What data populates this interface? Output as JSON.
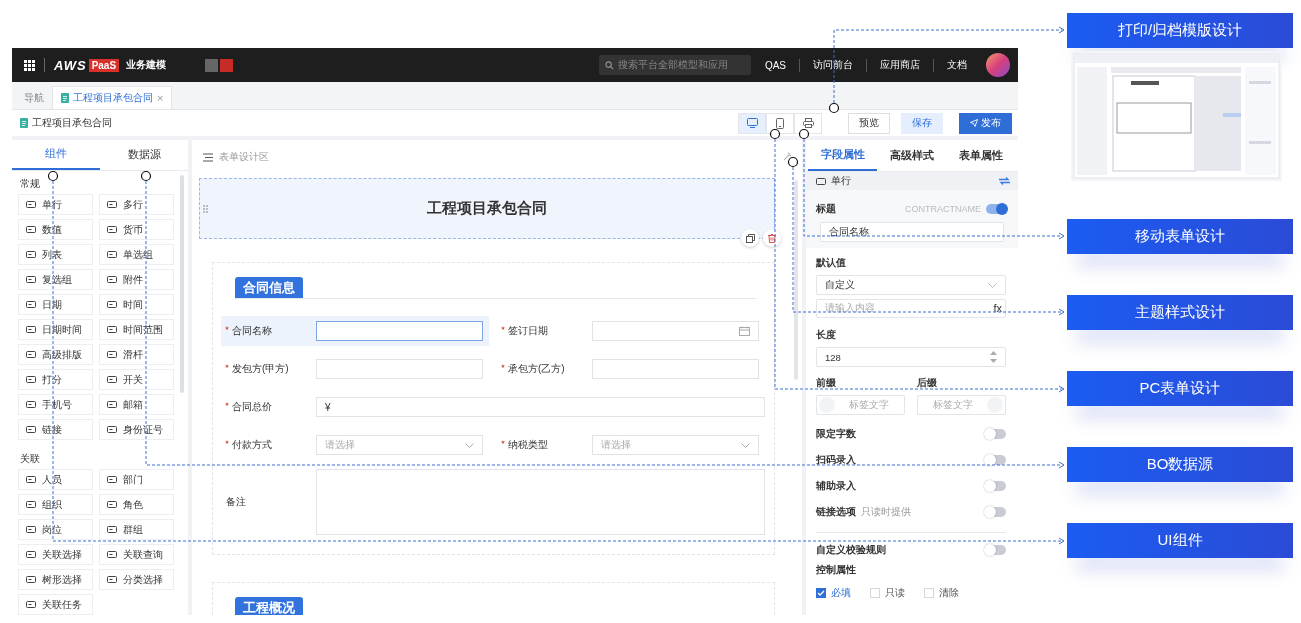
{
  "topbar": {
    "logo_text": "AWS",
    "logo_badge": "PaaS",
    "product": "业务建模",
    "search_placeholder": "搜索平台全部模型和应用",
    "nav": [
      "QAS",
      "访问前台",
      "应用商店",
      "文档"
    ]
  },
  "tabs": [
    {
      "label": "导航",
      "selected": false
    },
    {
      "label": "工程项目承包合同",
      "selected": true,
      "close": "×"
    }
  ],
  "doc_title": "工程项目承包合同",
  "view_toggles": [
    {
      "kind": "desktop",
      "selected": true
    },
    {
      "kind": "mobile",
      "selected": false
    },
    {
      "kind": "print",
      "selected": false
    }
  ],
  "buttons": [
    {
      "label": "预览",
      "kind": "default"
    },
    {
      "label": "保存",
      "kind": "light"
    },
    {
      "label": "发布",
      "kind": "primary"
    }
  ],
  "palette": {
    "tabs": [
      {
        "label": "组件",
        "selected": true
      },
      {
        "label": "数据源",
        "selected": false
      }
    ],
    "groups": [
      {
        "title": "常规",
        "items": [
          "单行",
          "多行",
          "数值",
          "货币",
          "列表",
          "单选组",
          "复选组",
          "附件",
          "日期",
          "时间",
          "日期时间",
          "时间范围",
          "高级排版",
          "滑杆",
          "打分",
          "开关",
          "手机号",
          "邮箱",
          "链接",
          "身份证号"
        ]
      },
      {
        "title": "关联",
        "items": [
          "人员",
          "部门",
          "组织",
          "角色",
          "岗位",
          "群组",
          "关联选择",
          "关联查询",
          "树形选择",
          "分类选择",
          "关联任务"
        ]
      }
    ]
  },
  "designer": {
    "header": "表单设计区",
    "form_title": "工程项目承包合同",
    "sections": [
      {
        "title": "合同信息",
        "fields": [
          {
            "label": "合同名称",
            "required": true,
            "kind": "text",
            "full": false,
            "selected": true
          },
          {
            "label": "签订日期",
            "required": true,
            "kind": "date",
            "full": false,
            "selected": false
          },
          {
            "label": "发包方(甲方)",
            "required": true,
            "kind": "text",
            "full": false,
            "selected": false
          },
          {
            "label": "承包方(乙方)",
            "required": true,
            "kind": "text",
            "full": false,
            "selected": false
          },
          {
            "label": "合同总价",
            "required": true,
            "kind": "money",
            "full": true,
            "selected": false,
            "value": "¥"
          },
          {
            "label": "付款方式",
            "required": true,
            "kind": "select",
            "full": false,
            "selected": false,
            "placeholder": "请选择"
          },
          {
            "label": "纳税类型",
            "required": true,
            "kind": "select",
            "full": false,
            "selected": false,
            "placeholder": "请选择"
          },
          {
            "label": "备注",
            "required": false,
            "kind": "textarea",
            "full": true,
            "selected": false
          }
        ]
      },
      {
        "title": "工程概况"
      }
    ]
  },
  "properties": {
    "tabs": [
      {
        "label": "字段属性",
        "selected": true
      },
      {
        "label": "高级样式",
        "selected": false
      },
      {
        "label": "表单属性",
        "selected": false
      }
    ],
    "field_type": "单行",
    "title": {
      "label": "标题",
      "code": "CONTRACTNAME",
      "on": true,
      "value": "合同名称"
    },
    "default": {
      "label": "默认值",
      "value": "自定义",
      "placeholder": "请输入内容",
      "fx": "fx"
    },
    "length": {
      "label": "长度",
      "value": "128"
    },
    "prefix": {
      "label": "前缀",
      "placeholder": "标签文字"
    },
    "suffix": {
      "label": "后缀",
      "placeholder": "标签文字"
    },
    "switches": [
      {
        "label": "限定字数",
        "on": false
      },
      {
        "label": "扫码录入",
        "on": false
      },
      {
        "label": "辅助录入",
        "on": false
      },
      {
        "label": "链接选项",
        "hint": "只读时提供",
        "on": false
      },
      {
        "label": "自定义校验规则",
        "on": false
      }
    ],
    "control": {
      "label": "控制属性",
      "options": [
        {
          "label": "必填",
          "checked": true
        },
        {
          "label": "只读",
          "checked": false
        },
        {
          "label": "清除",
          "checked": false
        }
      ]
    }
  },
  "callouts": [
    {
      "label": "打印/归档模版设计"
    },
    {
      "label": "移动表单设计"
    },
    {
      "label": "主题样式设计"
    },
    {
      "label": "PC表单设计"
    },
    {
      "label": "BO数据源"
    },
    {
      "label": "UI组件"
    }
  ]
}
